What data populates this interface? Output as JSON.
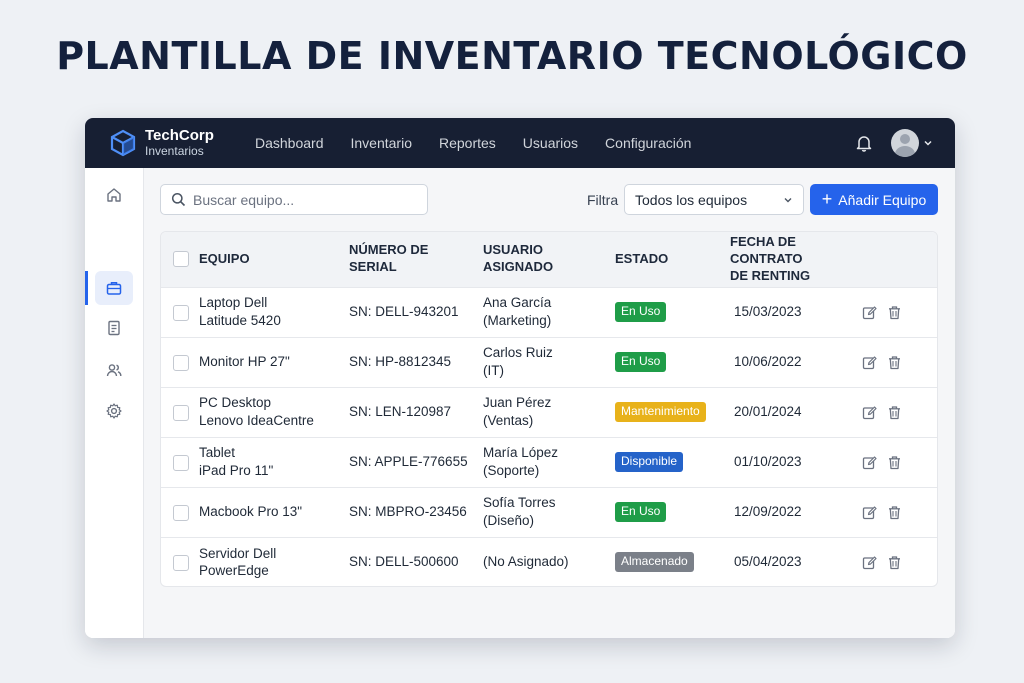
{
  "page": {
    "title": "PLANTILLA DE INVENTARIO TECNOLÓGICO"
  },
  "brand": {
    "name": "TechCorp",
    "subtitle": "Inventarios"
  },
  "nav": [
    "Dashboard",
    "Inventario",
    "Reportes",
    "Usuarios",
    "Configuración"
  ],
  "sidebar": {
    "items": [
      {
        "icon": "home-icon"
      },
      {
        "icon": "briefcase-icon",
        "active": true
      },
      {
        "icon": "document-icon"
      },
      {
        "icon": "users-icon"
      },
      {
        "icon": "gear-icon"
      }
    ]
  },
  "toolbar": {
    "search_placeholder": "Buscar equipo...",
    "filter_label": "Filtra",
    "filter_value": "Todos los equipos",
    "add_label": "Añadir Equipo"
  },
  "table": {
    "headers": {
      "equipo": "EQUIPO",
      "serial_1": "NÚMERO DE",
      "serial_2": "SERIAL",
      "usuario_1": "USUARIO",
      "usuario_2": "ASIGNADO",
      "estado": "ESTADO",
      "fecha_1": "FECHA DE CONTRATO",
      "fecha_2": "DE RENTING"
    },
    "rows": [
      {
        "equipo_1": "Laptop Dell",
        "equipo_2": "Latitude 5420",
        "serial": "SN: DELL-943201",
        "usuario_1": "Ana García",
        "usuario_2": "(Marketing)",
        "estado": "En Uso",
        "estado_color": "#1f9d48",
        "fecha": "15/03/2023"
      },
      {
        "equipo_1": "Monitor HP 27\"",
        "equipo_2": "",
        "serial": "SN: HP-8812345",
        "usuario_1": "Carlos Ruiz",
        "usuario_2": "(IT)",
        "estado": "En Uso",
        "estado_color": "#1f9d48",
        "fecha": "10/06/2022"
      },
      {
        "equipo_1": "PC Desktop",
        "equipo_2": "Lenovo IdeaCentre",
        "serial": "SN: LEN-120987",
        "usuario_1": "Juan Pérez",
        "usuario_2": "(Ventas)",
        "estado": "Mantenimiento",
        "estado_color": "#e8b21a",
        "fecha": "20/01/2024"
      },
      {
        "equipo_1": "Tablet",
        "equipo_2": "iPad Pro 11\"",
        "serial": "SN: APPLE-776655",
        "usuario_1": "María López",
        "usuario_2": "(Soporte)",
        "estado": "Disponible",
        "estado_color": "#2563c9",
        "fecha": "01/10/2023"
      },
      {
        "equipo_1": "Macbook Pro 13\"",
        "equipo_2": "",
        "serial": "SN: MBPRO-23456",
        "usuario_1": "Sofía Torres",
        "usuario_2": "(Diseño)",
        "estado": "En Uso",
        "estado_color": "#1f9d48",
        "fecha": "12/09/2022"
      },
      {
        "equipo_1": "Servidor Dell",
        "equipo_2": "PowerEdge",
        "serial": "SN: DELL-500600",
        "usuario_1": "(No Asignado)",
        "usuario_2": "",
        "estado": "Almacenado",
        "estado_color": "#7b8089",
        "fecha": "05/04/2023"
      }
    ]
  },
  "colors": {
    "topbar": "#171f33",
    "accent": "#2563eb",
    "title": "#14213d"
  }
}
